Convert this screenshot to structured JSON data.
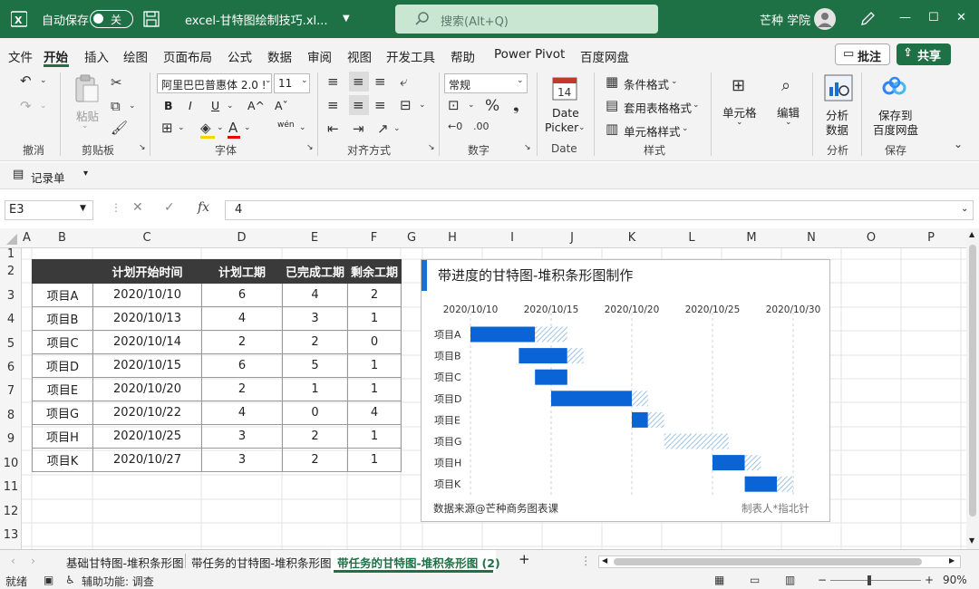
{
  "titlebar": {
    "autosave_label": "自动保存",
    "autosave_state": "关",
    "filename": "excel-甘特图绘制技巧.xl...",
    "search_placeholder": "搜索(Alt+Q)",
    "user": "芒种 学院",
    "min": "—",
    "max": "☐",
    "close": "✕"
  },
  "menu": {
    "items": [
      "文件",
      "开始",
      "插入",
      "绘图",
      "页面布局",
      "公式",
      "数据",
      "审阅",
      "视图",
      "开发工具",
      "帮助",
      "Power Pivot",
      "百度网盘"
    ],
    "comment": "批注",
    "share": "共享"
  },
  "ribbon": {
    "undo_group": "撤消",
    "paste": "粘贴",
    "clipboard_group": "剪贴板",
    "font_name": "阿里巴巴普惠体 2.0 !",
    "font_size": "11",
    "font_group": "字体",
    "bold": "B",
    "italic": "I",
    "underline": "U",
    "grow": "A^",
    "shrink": "Aˇ",
    "wen": "wén",
    "align_group": "对齐方式",
    "num_format": "常规",
    "number_group": "数字",
    "date_picker_l1": "Date",
    "date_picker_l2": "Picker",
    "date_picker_group": "Date",
    "calendar_day": "14",
    "cond_format": "条件格式",
    "table_format": "套用表格格式",
    "cell_style": "单元格样式",
    "style_group": "样式",
    "cells": "单元格",
    "edit": "编辑",
    "analyze_l1": "分析",
    "analyze_l2": "数据",
    "analyze_group": "分析",
    "save_l1": "保存到",
    "save_l2": "百度网盘",
    "save_group": "保存"
  },
  "quickbar": {
    "record": "记录单"
  },
  "formula": {
    "cell": "E3",
    "fx": "fx",
    "value": "4"
  },
  "columns": [
    "A",
    "B",
    "C",
    "D",
    "E",
    "F",
    "G",
    "H",
    "I",
    "J",
    "K",
    "L",
    "M",
    "N",
    "O",
    "P"
  ],
  "rows": [
    "1",
    "2",
    "3",
    "4",
    "5",
    "6",
    "7",
    "8",
    "9",
    "10",
    "11",
    "12",
    "13"
  ],
  "table": {
    "headers": [
      "",
      "计划开始时间",
      "计划工期",
      "已完成工期",
      "剩余工期"
    ],
    "rows": [
      [
        "项目A",
        "2020/10/10",
        "6",
        "4",
        "2"
      ],
      [
        "项目B",
        "2020/10/13",
        "4",
        "3",
        "1"
      ],
      [
        "项目C",
        "2020/10/14",
        "2",
        "2",
        "0"
      ],
      [
        "项目D",
        "2020/10/15",
        "6",
        "5",
        "1"
      ],
      [
        "项目E",
        "2020/10/20",
        "2",
        "1",
        "1"
      ],
      [
        "项目G",
        "2020/10/22",
        "4",
        "0",
        "4"
      ],
      [
        "项目H",
        "2020/10/25",
        "3",
        "2",
        "1"
      ],
      [
        "项目K",
        "2020/10/27",
        "3",
        "2",
        "1"
      ]
    ]
  },
  "chart_data": {
    "type": "bar",
    "title": "带进度的甘特图-堆积条形图制作",
    "x_ticks": [
      "2020/10/10",
      "2020/10/15",
      "2020/10/20",
      "2020/10/25",
      "2020/10/30"
    ],
    "xlim": [
      "2020/10/10",
      "2020/10/30"
    ],
    "categories": [
      "项目A",
      "项目B",
      "项目C",
      "项目D",
      "项目E",
      "项目G",
      "项目H",
      "项目K"
    ],
    "start": [
      "2020/10/10",
      "2020/10/13",
      "2020/10/14",
      "2020/10/15",
      "2020/10/20",
      "2020/10/22",
      "2020/10/25",
      "2020/10/27"
    ],
    "series": [
      {
        "values": [
          4,
          3,
          2,
          5,
          1,
          0,
          2,
          2
        ],
        "color": "#0b64d6"
      },
      {
        "values": [
          2,
          1,
          0,
          1,
          1,
          4,
          1,
          1
        ],
        "color": "#9dc3e6"
      }
    ],
    "source": "数据来源@芒种商务图表课",
    "author": "制表人*指北针"
  },
  "tabs": {
    "items": [
      "基础甘特图-堆积条形图",
      "带任务的甘特图-堆积条形图",
      "带任务的甘特图-堆积条形图 (2)"
    ],
    "add": "+"
  },
  "status": {
    "ready": "就绪",
    "accessibility": "辅助功能: 调查",
    "zoom": "90%"
  }
}
